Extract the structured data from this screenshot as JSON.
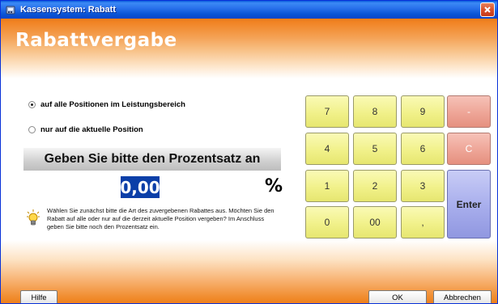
{
  "window": {
    "title": "Kassensystem: Rabatt",
    "close_symbol": "✕"
  },
  "header": {
    "title": "Rabattvergabe"
  },
  "options": [
    {
      "label": "auf alle Positionen im Leistungsbereich",
      "selected": true
    },
    {
      "label": "nur auf die aktuelle Position",
      "selected": false
    }
  ],
  "prompt": {
    "text": "Geben Sie bitte den Prozentsatz an",
    "value": "0,00",
    "unit": "%"
  },
  "info": {
    "icon": "lightbulb-icon",
    "text": "Wählen Sie zunächst bitte die Art des zuvergebenen Rabattes aus. Möchten Sie den Rabatt auf alle oder nur auf die derzeit aktuelle Position vergeben? Im Anschluss geben Sie bitte noch den Prozentsatz ein."
  },
  "keypad": {
    "keys": [
      "7",
      "8",
      "9",
      "-",
      "4",
      "5",
      "6",
      "C",
      "1",
      "2",
      "3",
      "0",
      "00",
      ",",
      "Enter"
    ]
  },
  "footer": {
    "help": "Hilfe",
    "ok": "OK",
    "cancel": "Abbrechen"
  },
  "colors": {
    "accent_orange": "#f07c18",
    "keypad_yellow": "#f1f18a",
    "keypad_red": "#eea597",
    "keypad_enter": "#a7adec",
    "value_highlight": "#0b3fa8"
  }
}
